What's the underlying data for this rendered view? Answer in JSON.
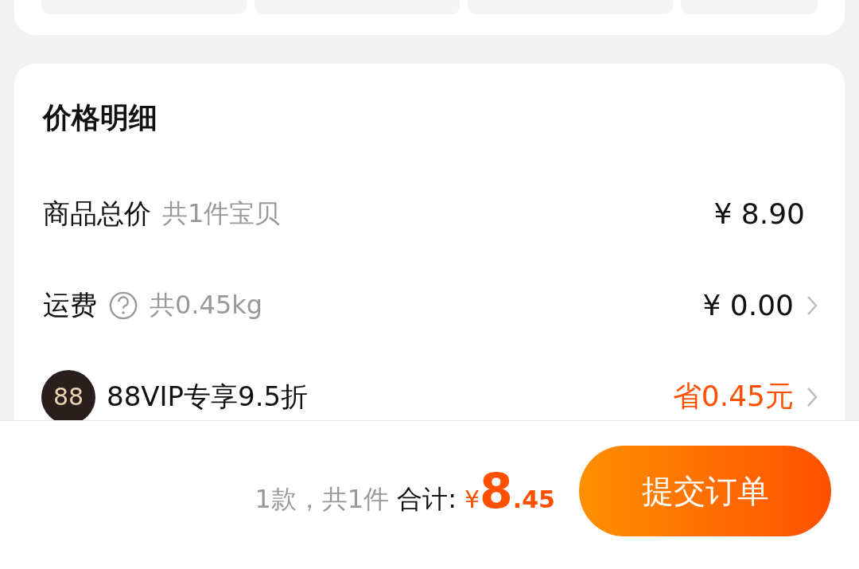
{
  "price_detail": {
    "title": "价格明细",
    "rows": [
      {
        "kind": "plain",
        "label": "商品总价",
        "note": "共1件宝贝",
        "value": "¥ 8.90",
        "chevron": false,
        "help": false
      },
      {
        "kind": "plain",
        "label": "运费",
        "note": "共0.45kg",
        "value": "¥ 0.00",
        "chevron": true,
        "help": true
      },
      {
        "kind": "discount",
        "label": "88VIP专享9.5折",
        "value": "省0.45元",
        "chevron": true,
        "help": false,
        "badge": "88"
      }
    ]
  },
  "footer": {
    "count": "1款，共1件",
    "total_label": "合计:",
    "currency": "¥",
    "integer": "8",
    "decimal": ".45",
    "submit": "提交订单"
  }
}
